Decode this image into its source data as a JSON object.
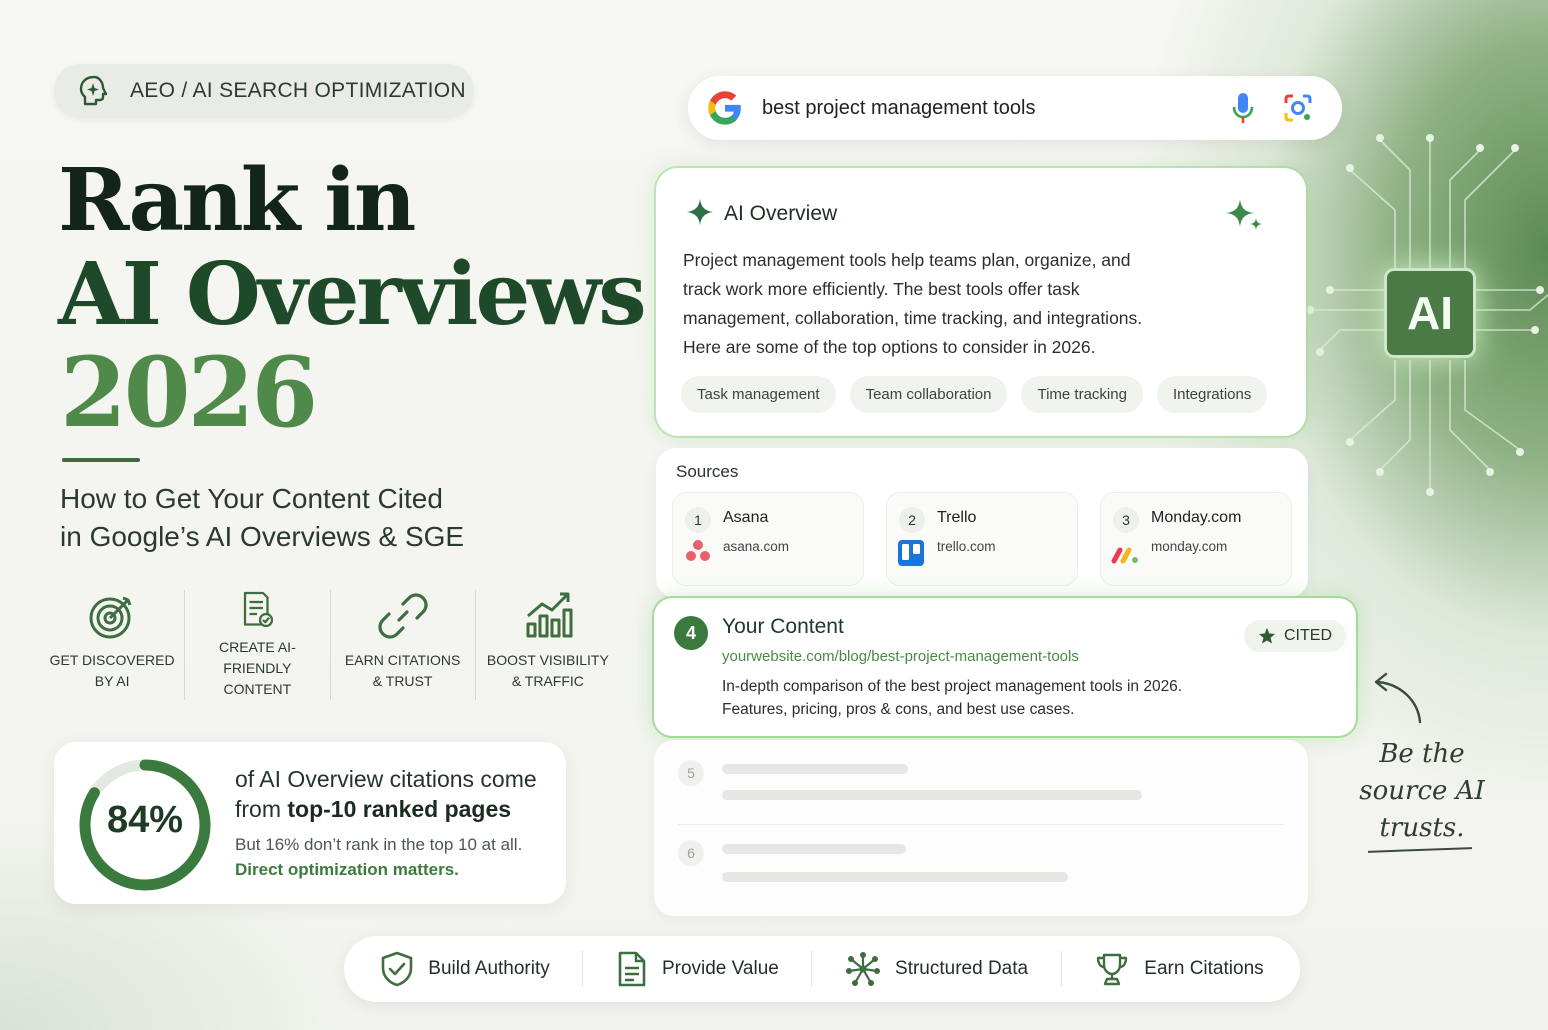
{
  "badge": {
    "icon": "brain-spark-icon",
    "text": "AEO / AI SEARCH OPTIMIZATION"
  },
  "hero": {
    "line1": "Rank in",
    "line2": "AI Overviews",
    "line3": "2026",
    "subtitle_line1": "How to Get Your Content Cited",
    "subtitle_line2": "in Google’s AI Overviews & SGE"
  },
  "features": [
    {
      "icon": "target-icon",
      "line1": "GET DISCOVERED",
      "line2": "BY AI"
    },
    {
      "icon": "document-check-icon",
      "line1": "CREATE AI-FRIENDLY",
      "line2": "CONTENT"
    },
    {
      "icon": "link-icon",
      "line1": "EARN CITATIONS",
      "line2": "& TRUST"
    },
    {
      "icon": "growth-chart-icon",
      "line1": "BOOST VISIBILITY",
      "line2": "& TRAFFIC"
    }
  ],
  "stat": {
    "percent_label": "84%",
    "percent_value": 84,
    "line1": "of AI Overview citations come",
    "line2_prefix": "from ",
    "line2_bold": "top-10 ranked pages",
    "line3": "But 16% don’t rank in the top 10 at all.",
    "line4": "Direct optimization matters."
  },
  "search": {
    "query": "best project management tools"
  },
  "overview": {
    "title": "AI Overview",
    "body_line1": "Project management tools help teams plan, organize, and",
    "body_line2": "track work more efficiently. The best tools offer task",
    "body_line3": "management, collaboration, time tracking, and integrations.",
    "body_line4": "Here are some of the top options to consider in 2026.",
    "chips": [
      "Task management",
      "Team collaboration",
      "Time tracking",
      "Integrations"
    ]
  },
  "sources": {
    "title": "Sources",
    "items": [
      {
        "num": "1",
        "name": "Asana",
        "domain": "asana.com",
        "color": "#e8606a"
      },
      {
        "num": "2",
        "name": "Trello",
        "domain": "trello.com",
        "color": "#1b74d8"
      },
      {
        "num": "3",
        "name": "Monday.com",
        "domain": "monday.com",
        "color": "#f2b420"
      }
    ]
  },
  "your_content": {
    "num": "4",
    "title": "Your Content",
    "url": "yourwebsite.com/blog/best-project-management-tools",
    "desc_line1": "In-depth comparison of the best project management tools in 2026.",
    "desc_line2": "Features, pricing, pros & cons, and best use cases.",
    "badge": "CITED"
  },
  "placeholders": [
    {
      "num": "5"
    },
    {
      "num": "6"
    }
  ],
  "note": {
    "line1": "Be the",
    "line2": "source AI",
    "line3": "trusts."
  },
  "ai_chip": {
    "label": "AI"
  },
  "bottom": [
    {
      "icon": "shield-check-icon",
      "label": "Build Authority"
    },
    {
      "icon": "document-icon",
      "label": "Provide Value"
    },
    {
      "icon": "network-icon",
      "label": "Structured Data"
    },
    {
      "icon": "trophy-icon",
      "label": "Earn Citations"
    }
  ],
  "colors": {
    "brand_green": "#3a7a3e",
    "dark_green": "#1e4a2a",
    "light_green": "#4f8a4a"
  }
}
